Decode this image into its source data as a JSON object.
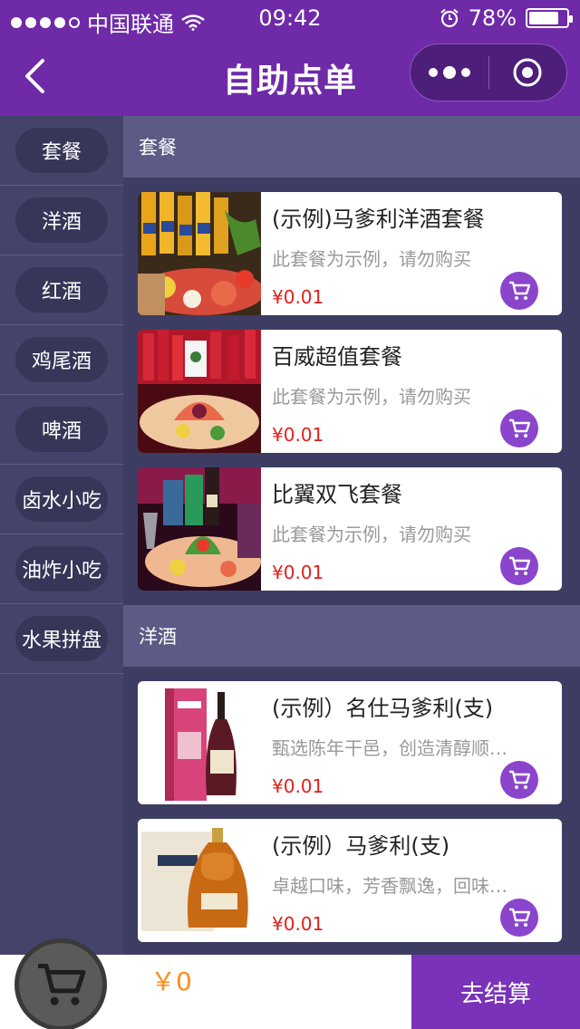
{
  "status_bar": {
    "carrier": "中国联通",
    "time": "09:42",
    "battery": "78%",
    "battery_level": 0.78,
    "signal_bars": 4,
    "icons": [
      "signal-icon",
      "wifi-icon",
      "alarm-icon",
      "battery-icon"
    ]
  },
  "nav": {
    "title": "自助点单",
    "back_icon": "chevron-left-icon",
    "more_icon": "more-dots-icon",
    "close_icon": "target-close-icon"
  },
  "sidebar": {
    "categories": [
      {
        "label": "套餐"
      },
      {
        "label": "洋酒"
      },
      {
        "label": "红酒"
      },
      {
        "label": "鸡尾酒"
      },
      {
        "label": "啤酒"
      },
      {
        "label": "卤水小吃"
      },
      {
        "label": "油炸小吃"
      },
      {
        "label": "水果拼盘"
      }
    ]
  },
  "sections": [
    {
      "title": "套餐",
      "products": [
        {
          "name": "(示例)马爹利洋酒套餐",
          "desc": "此套餐为示例，请勿购买",
          "price": "¥0.01",
          "image": "beer-fruit-platter"
        },
        {
          "name": "百威超值套餐",
          "desc": "此套餐为示例，请勿购买",
          "price": "¥0.01",
          "image": "budweiser-fruit-platter"
        },
        {
          "name": "比翼双飞套餐",
          "desc": "此套餐为示例，请勿购买",
          "price": "¥0.01",
          "image": "drinks-fruit-platter"
        }
      ]
    },
    {
      "title": "洋酒",
      "products": [
        {
          "name": "(示例）名仕马爹利(支)",
          "desc": "甄选陈年干邑，创造清醇顺…",
          "price": "¥0.01",
          "image": "martell-noblige-bottle"
        },
        {
          "name": "(示例）马爹利(支)",
          "desc": "卓越口味，芳香飘逸，回味…",
          "price": "¥0.01",
          "image": "martell-xo-bottle"
        }
      ]
    }
  ],
  "bottom_bar": {
    "total": "￥0",
    "checkout_label": "去结算",
    "cart_icon": "shopping-cart-icon"
  },
  "colors": {
    "brand_purple": "#6f2aa8",
    "sidebar_bg": "#44446b",
    "content_bg": "#3d3d63",
    "section_header_bg": "#5b5b85",
    "price_red": "#e0201c",
    "total_orange": "#ff8c1a",
    "cart_button_purple": "#8a45cc"
  }
}
